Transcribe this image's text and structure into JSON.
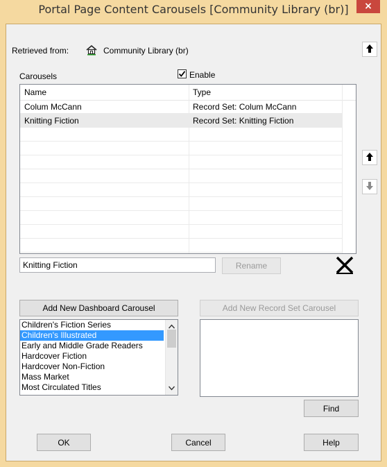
{
  "window": {
    "title": "Portal Page Content Carousels [Community Library  (br)]",
    "close_label": "×"
  },
  "retrieved": {
    "label": "Retrieved from:",
    "library": "Community Library  (br)"
  },
  "carousels": {
    "label": "Carousels",
    "enable_label": "Enable",
    "enable_checked": true,
    "columns": [
      "Name",
      "Type"
    ],
    "rows": [
      {
        "name": "Colum McCann",
        "type": "Record Set: Colum McCann"
      },
      {
        "name": "Knitting Fiction",
        "type": "Record Set: Knitting Fiction"
      }
    ],
    "selected_index": 1
  },
  "rename": {
    "value": "Knitting Fiction",
    "button_label": "Rename"
  },
  "dashboard": {
    "button_label": "Add New Dashboard Carousel",
    "items": [
      "Children's Fiction Series",
      "Children's Illustrated",
      "Early and Middle Grade Readers",
      "Hardcover Fiction",
      "Hardcover Non-Fiction",
      "Mass Market",
      "Most Circulated Titles"
    ],
    "selected_index": 1
  },
  "record_set": {
    "button_label": "Add New Record Set Carousel",
    "find_label": "Find"
  },
  "footer": {
    "ok_label": "OK",
    "cancel_label": "Cancel",
    "help_label": "Help"
  },
  "icons": {
    "home": "home-icon",
    "up": "arrow-up-icon",
    "down": "arrow-down-icon",
    "delete": "delete-x-icon",
    "check": "checkmark-icon"
  }
}
